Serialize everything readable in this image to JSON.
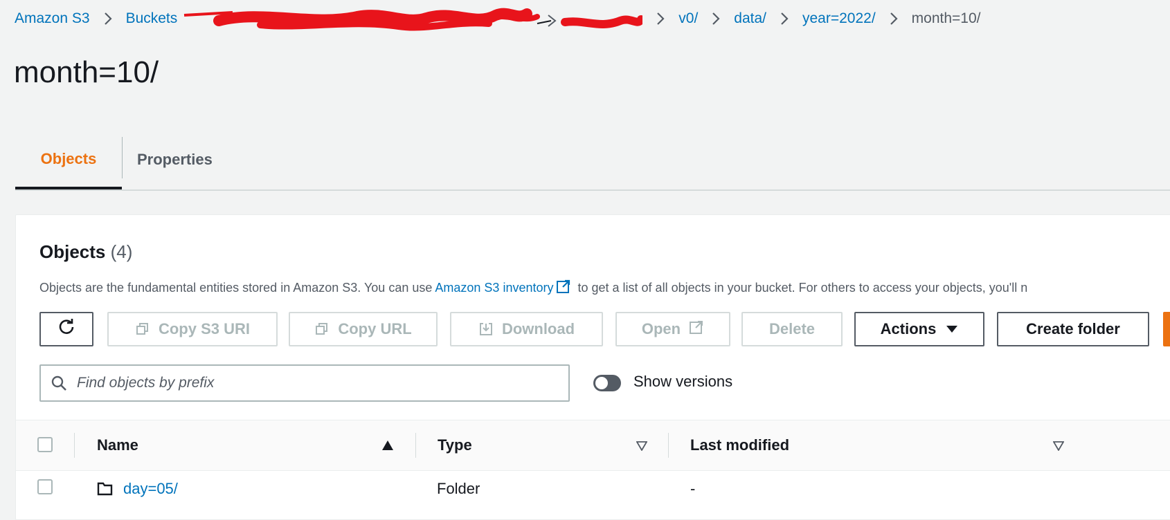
{
  "breadcrumb": {
    "root": "Amazon S3",
    "buckets": "Buckets",
    "v0": "v0/",
    "data": "data/",
    "year": "year=2022/",
    "current": "month=10/"
  },
  "page": {
    "title": "month=10/"
  },
  "tabs": [
    {
      "label": "Objects",
      "active": true
    },
    {
      "label": "Properties",
      "active": false
    }
  ],
  "objects_panel": {
    "heading": "Objects",
    "count": "(4)",
    "description_before": "Objects are the fundamental entities stored in Amazon S3. You can use",
    "inventory_link": "Amazon S3 inventory",
    "description_after": "to get a list of all objects in your bucket. For others to access your objects, you'll n"
  },
  "toolbar": {
    "copy_s3_uri": "Copy S3 URI",
    "copy_url": "Copy URL",
    "download": "Download",
    "open": "Open",
    "delete": "Delete",
    "actions": "Actions",
    "create_folder": "Create folder"
  },
  "search": {
    "placeholder": "Find objects by prefix",
    "value": ""
  },
  "show_versions": {
    "label": "Show versions",
    "enabled": false
  },
  "table": {
    "columns": [
      "Name",
      "Type",
      "Last modified"
    ],
    "rows": [
      {
        "name": "day=05/",
        "type": "Folder",
        "last_modified": "-"
      }
    ]
  },
  "colors": {
    "link": "#0073bb",
    "accent": "#ec7211",
    "redaction": "#e8141b"
  }
}
